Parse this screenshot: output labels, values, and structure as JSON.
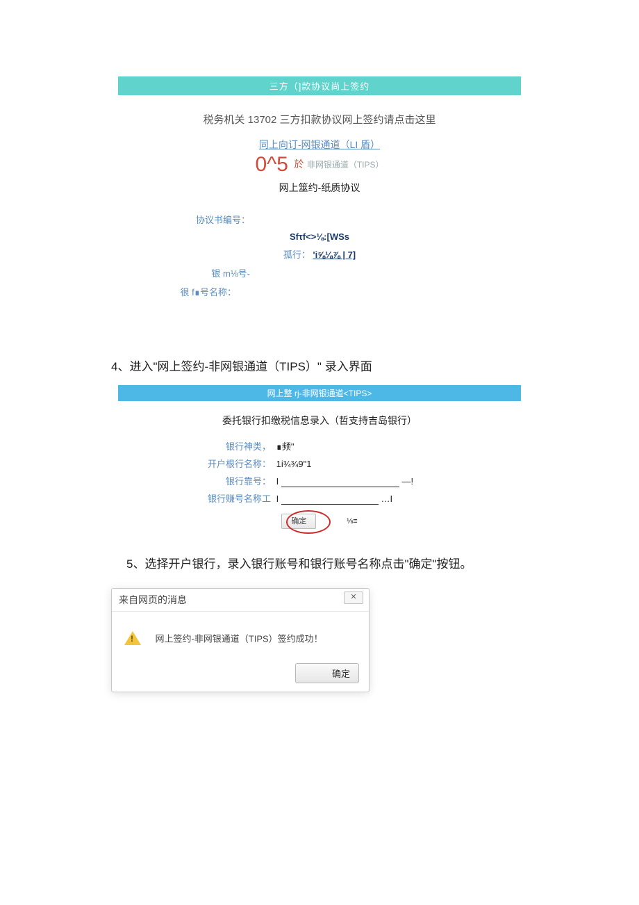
{
  "panel1": {
    "header": "三方（]款协议尚上签约",
    "line1": "税务机关 13702 三方扣款协议网上签约请点击这里",
    "link_top": "同上向订-网银通道（LI 盾）",
    "big_red": "0^5",
    "yu": "於",
    "tips_link": "非网银通道（TIPS）",
    "paper_line": "网上筮约-纸质协议",
    "label_protocol_no": "协议书编号：",
    "value_protocol": "Sfτf<>⅛:[WSs",
    "label_gu": "孤行：",
    "value_gu": "'i⅝⅛⅞ | 7]",
    "label_bank_no": "银 m⅛号-",
    "label_name": "很 f∎号名称："
  },
  "step4": "4、进入\"网上签约-非网银通道（TIPS）\" 录入界面",
  "panel2": {
    "header": "网上整 rj-非网银通道<TIPS>",
    "title": "委托银行扣缴税信息录入（哲支持吉岛银行）",
    "row1_label": "银行神类，",
    "row1_value": "∎频\"",
    "row2_label": "开户根行名称：",
    "row2_value": "1i¾¾9\"1",
    "row3_label": "银行靠号：",
    "row3_prefix": "I",
    "row3_suffix": "—!",
    "row4_label": "银行赚号名称工",
    "row4_prefix": "I",
    "row4_suffix": "…I",
    "confirm_btn": "确定",
    "frac": "⅛≡"
  },
  "step5": "5、选择开户银行，录入银行账号和银行账号名称点击\"确定\"按钮。",
  "dialog": {
    "title": "来自网页的消息",
    "close": "✕",
    "message": "网上签约-非网银通道（TIPS）签约成功！",
    "ok": "确定"
  }
}
